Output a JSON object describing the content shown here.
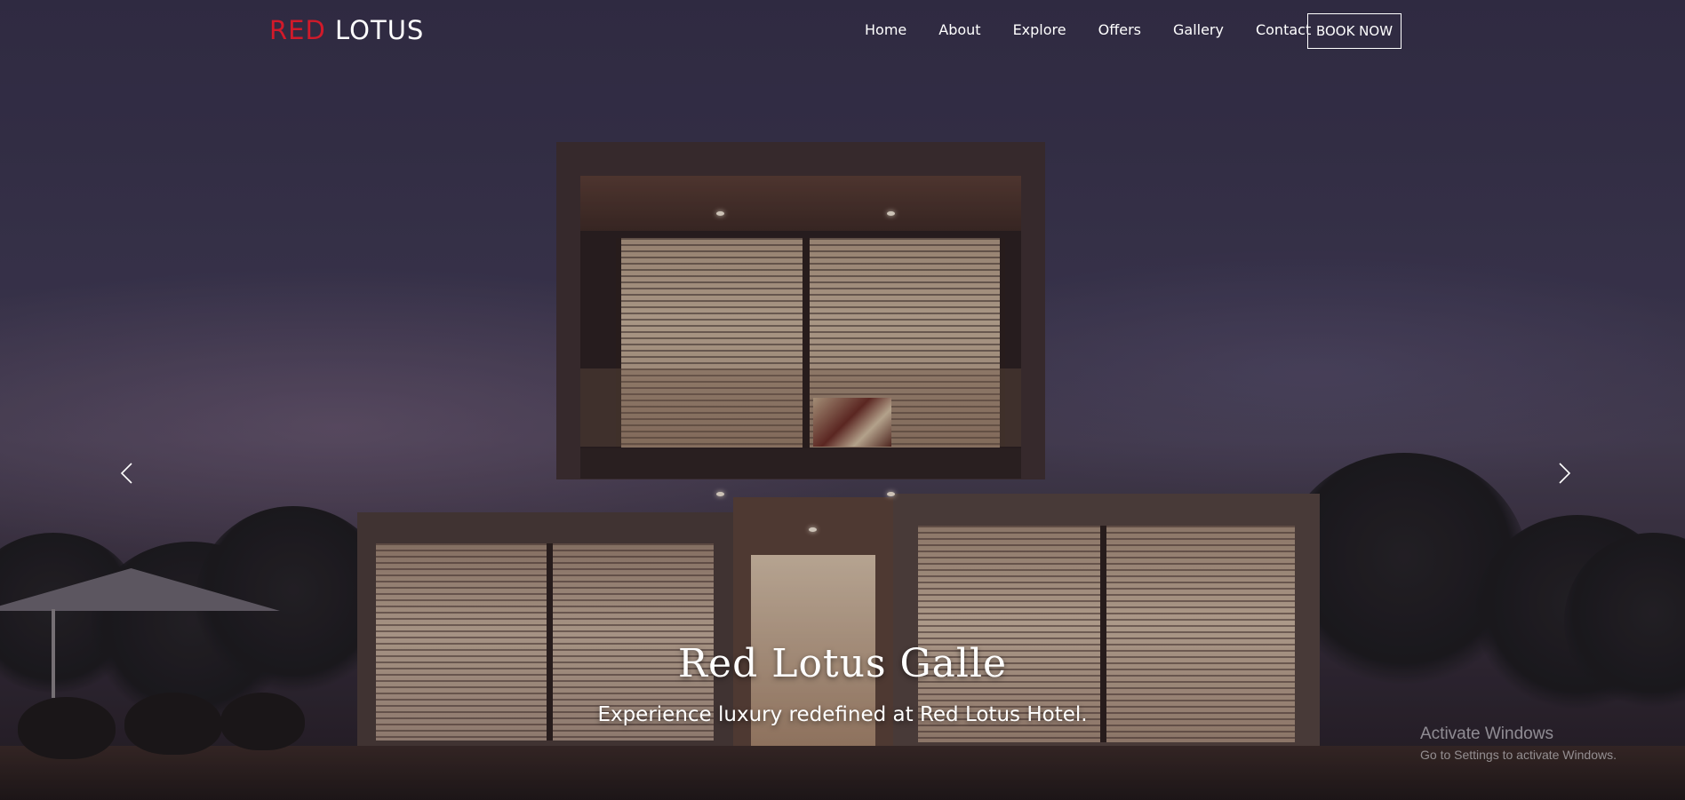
{
  "brand": {
    "logo_part1": "RED",
    "logo_part2": "LOTUS",
    "accent_color": "#d11a2a"
  },
  "nav": {
    "items": [
      {
        "label": "Home"
      },
      {
        "label": "About"
      },
      {
        "label": "Explore"
      },
      {
        "label": "Offers"
      },
      {
        "label": "Gallery"
      },
      {
        "label": "Contact"
      }
    ],
    "book_button": "BOOK NOW"
  },
  "carousel": {
    "prev_icon": "chevron-left-icon",
    "next_icon": "chevron-right-icon",
    "slide": {
      "title": "Red Lotus Galle",
      "subtitle": "Experience luxury redefined at Red Lotus Hotel."
    }
  },
  "watermark": {
    "title": "Activate Windows",
    "subtitle": "Go to Settings to activate Windows."
  }
}
